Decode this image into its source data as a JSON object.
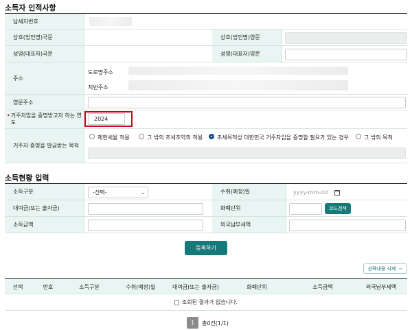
{
  "section1": {
    "title": "소득자 인적사항",
    "taxpayer_no_label": "납세자번호",
    "name_kr_label": "상호(법인명)국문",
    "name_en_label": "상호(법인명)영문",
    "rep_kr_label": "성명(대표자)국문",
    "rep_en_label": "성명(대표자)영문",
    "address_label": "주소",
    "road_address_label": "도로명주소",
    "lot_address_label": "지번주소",
    "eng_address_label": "영문주소",
    "residence_year_label": "거주자임을 증명받고자 하는 연도",
    "residence_year_value": "2024",
    "purpose_label": "거주자 증명을 발급받는 목적",
    "purposes": [
      "제한세율 적용",
      "그 밖의 조세조약의 적용",
      "조세목적상 대한민국 거주자임을 증명할 필요가 있는 경우",
      "그 밖의 목적"
    ],
    "selected_purpose_index": 2
  },
  "section2": {
    "title": "소득현황 입력",
    "income_type_label": "소득구분",
    "income_type_value": "-선택-",
    "receipt_date_label": "수취(예정)일",
    "receipt_date_placeholder": "yyyy-mm-dd",
    "lender_label": "대여금(또는 출자금)",
    "currency_label": "화폐단위",
    "code_search_button": "코드검색",
    "income_amount_label": "소득금액",
    "foreign_tax_label": "외국납부세액",
    "register_button": "등록하기",
    "delete_selected_button": "선택내용 삭제",
    "delete_symbol": "−"
  },
  "table": {
    "headers": [
      "선택",
      "번호",
      "소득구분",
      "수취(예정)일",
      "대여금(또는 출자금)",
      "화폐단위",
      "소득금액",
      "외국납부세액"
    ],
    "empty_message": "조회된 결과가 없습니다."
  },
  "pagination": {
    "current_page": "1",
    "total_text": "총0건(1/1)"
  },
  "colors": {
    "accent": "#177a7a",
    "label_bg": "#e9f5f2",
    "highlight_border": "#d0021b",
    "radio_selected": "#1a4d8c"
  }
}
